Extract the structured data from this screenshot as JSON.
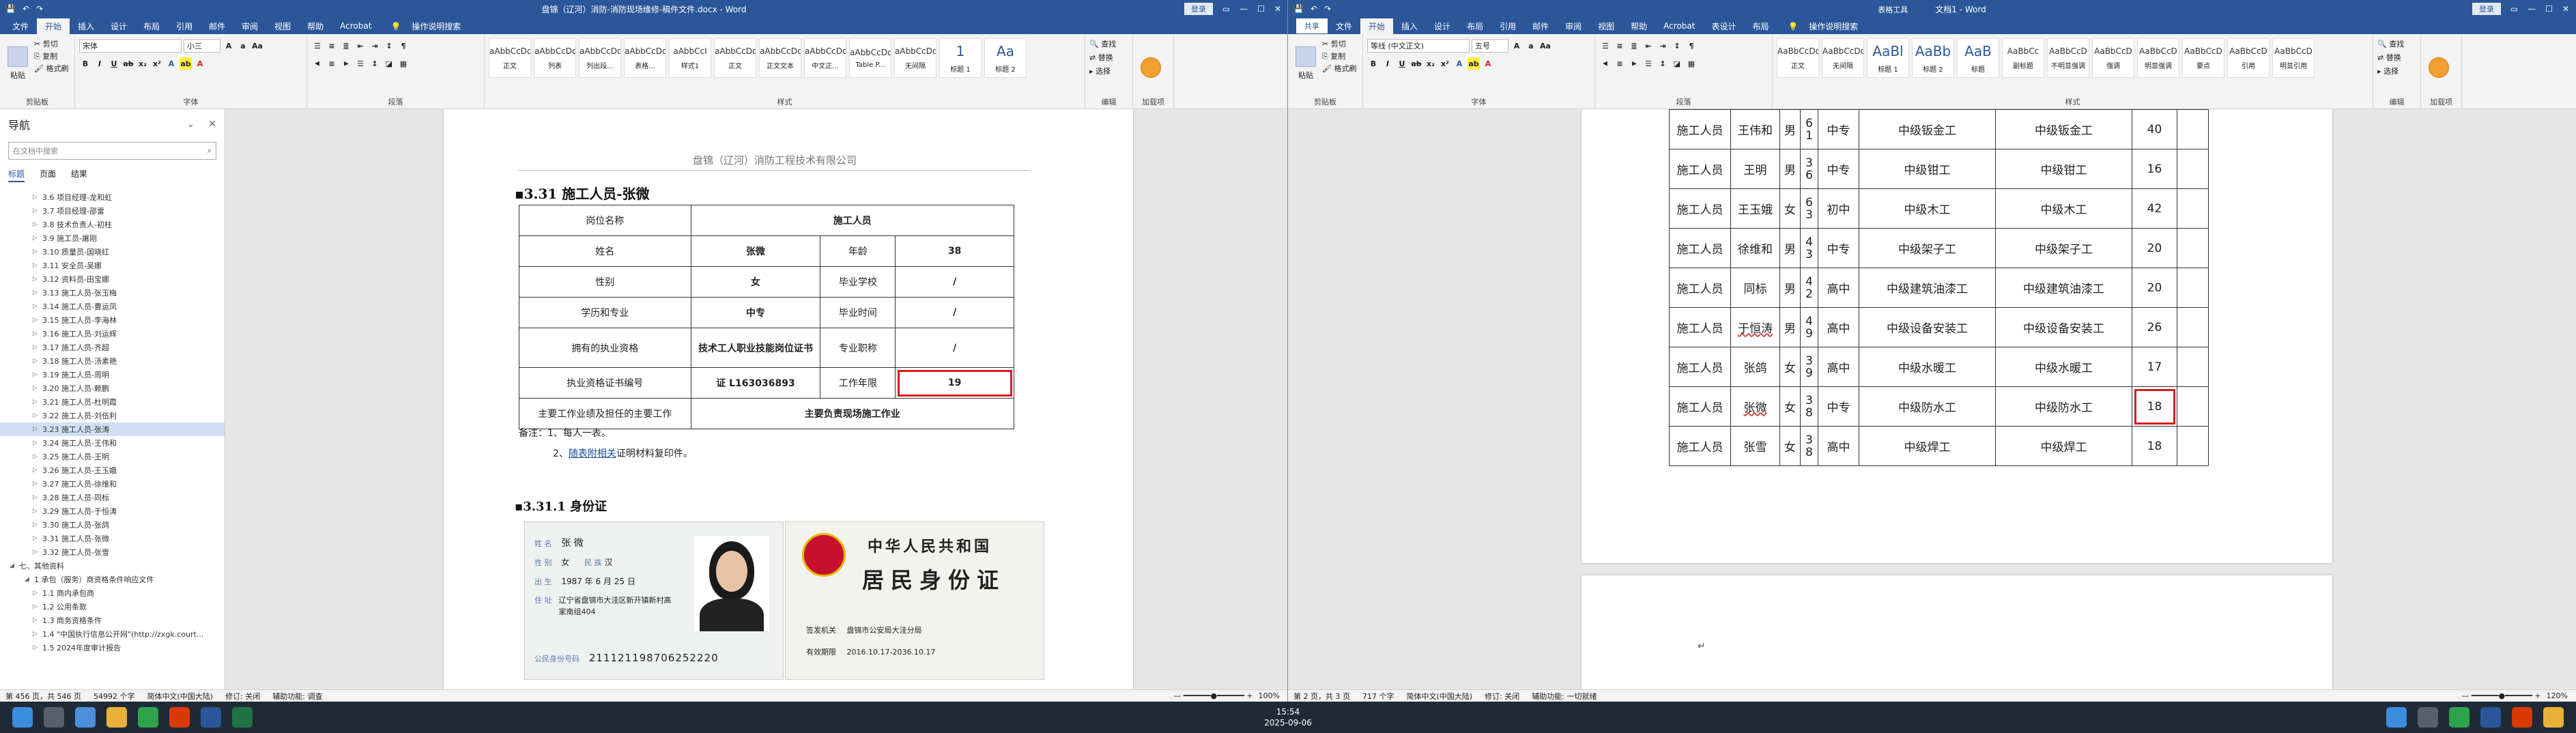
{
  "left_window": {
    "title": "盘锦（辽河）消防-消防现场维修-稿件文件.docx - Word",
    "login_label": "登录",
    "menu": [
      "文件",
      "开始",
      "插入",
      "设计",
      "布局",
      "引用",
      "邮件",
      "审阅",
      "视图",
      "帮助",
      "Acrobat"
    ],
    "tell_me": "操作说明搜索",
    "ribbon": {
      "clipboard_label": "剪贴板",
      "paste": "粘贴",
      "cut": "剪切",
      "copy": "复制",
      "format_painter": "格式刷",
      "font_label": "字体",
      "font_name": "宋体",
      "font_size": "小三",
      "paragraph_label": "段落",
      "styles_label": "样式",
      "styles": [
        {
          "preview": "aAbbCcDd",
          "name": "正文"
        },
        {
          "preview": "aAbbCcDd",
          "name": "列表"
        },
        {
          "preview": "aAbbCcDd",
          "name": "列出段..."
        },
        {
          "preview": "aAbbCcDd",
          "name": "表格..."
        },
        {
          "preview": "aAbbCcI",
          "name": "样式1"
        },
        {
          "preview": "aAbbCcDd",
          "name": "正文"
        },
        {
          "preview": "aAbbCcDd",
          "name": "正文文本"
        },
        {
          "preview": "aAbbCcDd",
          "name": "中文正..."
        },
        {
          "preview": "aAbbCcDd",
          "name": "Table P..."
        },
        {
          "preview": "aAbbCcDd",
          "name": "无间隔"
        },
        {
          "preview": "1",
          "name": "标题 1"
        },
        {
          "preview": "Aa",
          "name": "标题 2"
        }
      ],
      "editing_label": "编辑",
      "find": "查找",
      "replace": "替换",
      "select": "选择",
      "sign_label": "加载项"
    },
    "nav": {
      "title": "导航",
      "search_placeholder": "在文档中搜索",
      "tabs": [
        "标题",
        "页面",
        "结果"
      ],
      "items": [
        "3.6 项目经理-龙和虹",
        "3.7 项目经理-邵雷",
        "3.8 技术负责人-初柱",
        "3.9 施工员-屠刚",
        "3.10 质量员-国晓红",
        "3.11 安全员-吴娜",
        "3.12 资料员-田宝娜",
        "3.13 施工人员-张玉梅",
        "3.14 施工人员-曹运凤",
        "3.15 施工人员-李海林",
        "3.16 施工人员-刘运辉",
        "3.17 施工人员-齐超",
        "3.18 施工人员-汤素艳",
        "3.19 施工人员-周明",
        "3.20 施工人员-赖鹏",
        "3.21 施工人员-杜明霞",
        "3.22 施工人员-刘伍利",
        "3.23 施工人员-张涛",
        "3.24 施工人员-王伟和",
        "3.25 施工人员-王明",
        "3.26 施工人员-王玉娥",
        "3.27 施工人员-徐维和",
        "3.28 施工人员-同标",
        "3.29 施工人员-于恒涛",
        "3.30 施工人员-张鸽",
        "3.31 施工人员-张微",
        "3.32 施工人员-张雪",
        "七、其他资料",
        "1 承包（服务）商资格条件响应文件",
        "1.1 商内承包商",
        "1.2 公用条款",
        "1.3 商务资格条件",
        "1.4 \"中国执行信息公开网\"(http://zxgk.court...",
        "1.5 2024年度审计报告"
      ],
      "selected_index": 17
    },
    "page": {
      "header": "盘锦（辽河）消防工程技术有限公司",
      "heading": "3.31 施工人员-张微",
      "table": {
        "post_label": "岗位名称",
        "post_value": "施工人员",
        "name_label": "姓名",
        "name_value": "张微",
        "age_label": "年龄",
        "age_value": "38",
        "gender_label": "性别",
        "gender_value": "女",
        "school_label": "毕业学校",
        "school_value": "/",
        "edu_label": "学历和专业",
        "edu_value": "中专",
        "gradtime_label": "毕业时间",
        "gradtime_value": "/",
        "qual_label": "拥有的执业资格",
        "qual_value": "技术工人职业技能岗位证书",
        "title_label": "专业职称",
        "title_value": "/",
        "cert_label": "执业资格证书编号",
        "cert_value": "证 L163036893",
        "years_label": "工作年限",
        "years_value": "19",
        "duty_label": "主要工作业绩及担任的主要工作",
        "duty_value": "主要负责现场施工作业"
      },
      "note1": "备注：1、每人一表。",
      "note2_prefix": "2、",
      "note2_link": "随表附相关",
      "note2_suffix": "证明材料复印件。",
      "sub_heading": "3.31.1 身份证",
      "id_front": {
        "name_label": "姓 名",
        "name": "张 微",
        "gender_label": "性 别",
        "gender": "女",
        "ethnic_label": "民 族",
        "ethnic": "汉",
        "birth_label": "出 生",
        "birth": "1987 年 6 月 25 日",
        "addr_label": "住 址",
        "addr": "辽宁省盘锦市大洼区新开镇新村高家南组404",
        "id_label": "公民身份号码",
        "id_number": "211121198706252220"
      },
      "id_back": {
        "country": "中华人民共和国",
        "card": "居民身份证",
        "authority_label": "签发机关",
        "authority": "盘锦市公安局大洼分局",
        "valid_label": "有效期限",
        "valid": "2016.10.17-2036.10.17"
      }
    },
    "status": {
      "page": "第 456 页，共 546 页",
      "words": "54992 个字",
      "lang": "简体中文(中国大陆)",
      "track": "修订: 关闭",
      "access": "辅助功能: 调查",
      "zoom": "100%"
    }
  },
  "right_window": {
    "title": "文档1 - Word",
    "table_tools": "表格工具",
    "login_label": "登录",
    "share_label": "共享",
    "menu": [
      "文件",
      "开始",
      "插入",
      "设计",
      "布局",
      "引用",
      "邮件",
      "审阅",
      "视图",
      "帮助",
      "Acrobat",
      "表设计",
      "布局"
    ],
    "tell_me": "操作说明搜索",
    "ribbon": {
      "clipboard_label": "剪贴板",
      "paste": "粘贴",
      "cut": "剪切",
      "copy": "复制",
      "format_painter": "格式刷",
      "font_label": "字体",
      "font_name": "等线 (中文正文)",
      "font_size": "五号",
      "paragraph_label": "段落",
      "styles_label": "样式",
      "styles": [
        {
          "preview": "AaBbCcDd",
          "name": "正文"
        },
        {
          "preview": "AaBbCcDd",
          "name": "无间隔"
        },
        {
          "preview": "AaBl",
          "name": "标题 1"
        },
        {
          "preview": "AaBb",
          "name": "标题 2"
        },
        {
          "preview": "AaB",
          "name": "标题"
        },
        {
          "preview": "AaBbCc",
          "name": "副标题"
        },
        {
          "preview": "AaBbCcD",
          "name": "不明显强调"
        },
        {
          "preview": "AaBbCcD",
          "name": "强调"
        },
        {
          "preview": "AaBbCcD",
          "name": "明显强调"
        },
        {
          "preview": "AaBbCcD",
          "name": "要点"
        },
        {
          "preview": "AaBbCcD",
          "name": "引用"
        },
        {
          "preview": "AaBbCcD",
          "name": "明显引用"
        }
      ],
      "editing_label": "编辑",
      "find": "查找",
      "replace": "替换",
      "select": "选择",
      "sign_label": "加载项"
    },
    "table_rows": [
      {
        "role": "施工人员",
        "name": "王伟和",
        "gender": "男",
        "age": "61",
        "edu": "中专",
        "cert": "中级钣金工",
        "work": "中级钣金工",
        "years": "40",
        "name_ul": false
      },
      {
        "role": "施工人员",
        "name": "王明",
        "gender": "男",
        "age": "36",
        "edu": "中专",
        "cert": "中级钳工",
        "work": "中级钳工",
        "years": "16",
        "name_ul": false
      },
      {
        "role": "施工人员",
        "name": "王玉娥",
        "gender": "女",
        "age": "63",
        "edu": "初中",
        "cert": "中级木工",
        "work": "中级木工",
        "years": "42",
        "name_ul": false
      },
      {
        "role": "施工人员",
        "name": "徐维和",
        "gender": "男",
        "age": "43",
        "edu": "中专",
        "cert": "中级架子工",
        "work": "中级架子工",
        "years": "20",
        "name_ul": false
      },
      {
        "role": "施工人员",
        "name": "同标",
        "gender": "男",
        "age": "42",
        "edu": "高中",
        "cert": "中级建筑油漆工",
        "work": "中级建筑油漆工",
        "years": "20",
        "name_ul": false
      },
      {
        "role": "施工人员",
        "name": "于恒涛",
        "gender": "男",
        "age": "49",
        "edu": "高中",
        "cert": "中级设备安装工",
        "work": "中级设备安装工",
        "years": "26",
        "name_ul": true
      },
      {
        "role": "施工人员",
        "name": "张鸽",
        "gender": "女",
        "age": "39",
        "edu": "高中",
        "cert": "中级水暖工",
        "work": "中级水暖工",
        "years": "17",
        "name_ul": false
      },
      {
        "role": "施工人员",
        "name": "张微",
        "gender": "女",
        "age": "38",
        "edu": "中专",
        "cert": "中级防水工",
        "work": "中级防水工",
        "years": "18",
        "name_ul": true
      },
      {
        "role": "施工人员",
        "name": "张雪",
        "gender": "女",
        "age": "38",
        "edu": "高中",
        "cert": "中级焊工",
        "work": "中级焊工",
        "years": "18",
        "name_ul": false
      }
    ],
    "highlight_row": 7,
    "status": {
      "page": "第 2 页，共 3 页",
      "words": "717 个字",
      "lang": "简体中文(中国大陆)",
      "track": "修订: 关闭",
      "access": "辅助功能: 一切就绪",
      "zoom": "120%"
    }
  },
  "taskbar": {
    "time": "15:54",
    "date": "2025-09-06"
  },
  "colors": {
    "word_blue": "#2b579a",
    "highlight_red": "#d61f1f"
  }
}
